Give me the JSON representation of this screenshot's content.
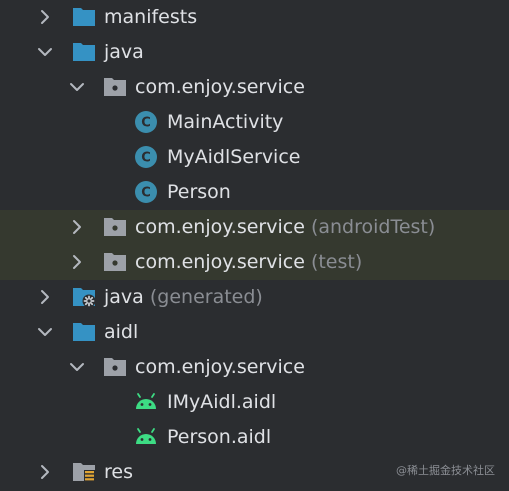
{
  "project_tree": {
    "rows": [
      {
        "label": "manifests",
        "suffix": "",
        "icon": "folder-blue-icon",
        "expanded": false
      },
      {
        "label": "java",
        "suffix": "",
        "icon": "folder-blue-icon",
        "expanded": true
      },
      {
        "label": "com.enjoy.service",
        "suffix": "",
        "icon": "package-icon",
        "expanded": true
      },
      {
        "label": "MainActivity",
        "suffix": "",
        "icon": "class-icon"
      },
      {
        "label": "MyAidlService",
        "suffix": "",
        "icon": "class-icon"
      },
      {
        "label": "Person",
        "suffix": "",
        "icon": "class-icon"
      },
      {
        "label": "com.enjoy.service",
        "suffix": "(androidTest)",
        "icon": "package-icon",
        "expanded": false
      },
      {
        "label": "com.enjoy.service",
        "suffix": "(test)",
        "icon": "package-icon",
        "expanded": false
      },
      {
        "label": "java",
        "suffix": "(generated)",
        "icon": "generated-folder-icon",
        "expanded": false
      },
      {
        "label": "aidl",
        "suffix": "",
        "icon": "folder-blue-icon",
        "expanded": true
      },
      {
        "label": "com.enjoy.service",
        "suffix": "",
        "icon": "package-icon",
        "expanded": true
      },
      {
        "label": "IMyAidl.aidl",
        "suffix": "",
        "icon": "android-icon"
      },
      {
        "label": "Person.aidl",
        "suffix": "",
        "icon": "android-icon"
      },
      {
        "label": "res",
        "suffix": "",
        "icon": "resources-folder-icon",
        "expanded": false
      }
    ]
  },
  "watermark": "@稀土掘金技术社区",
  "colors": {
    "background": "#2b2d30",
    "highlight_row": "#35392f",
    "text": "#dfe1e5",
    "secondary_text": "#8a8d93",
    "folder_blue": "#3592c4",
    "class_icon": "#3b8eae",
    "android_green": "#3ddc84"
  }
}
